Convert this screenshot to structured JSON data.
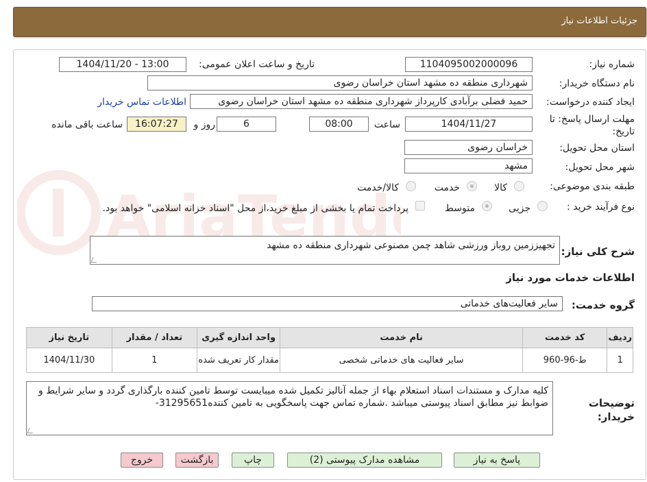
{
  "header": {
    "title": "جزئیات اطلاعات نیاز"
  },
  "watermark": {
    "text": "AriaTender.neT"
  },
  "fields": {
    "need_number_label": "شماره نیاز:",
    "need_number": "1104095002000096",
    "announce_label": "تاریخ و ساعت اعلان عمومی:",
    "announce_value": "1404/11/20 - 13:00",
    "buyer_label": "نام دستگاه خریدار:",
    "buyer_value": "شهرداری منطقه ده مشهد استان خراسان رضوی",
    "creator_label": "ایجاد کننده درخواست:",
    "creator_value": "حمید فضلی برآبادی کارپرداز شهرداری منطقه ده مشهد استان خراسان رضوی",
    "contact_link": "اطلاعات تماس خریدار",
    "deadline_label": "مهلت ارسال پاسخ: تا تاریخ:",
    "deadline_date": "1404/11/27",
    "time_label": "ساعت",
    "deadline_time": "08:00",
    "days_value": "6",
    "days_label": "روز و",
    "remaining_time": "16:07:27",
    "remaining_label": "ساعت باقی مانده",
    "province_label": "استان محل تحویل:",
    "province_value": "خراسان رضوی",
    "city_label": "شهر محل تحویل:",
    "city_value": "مشهد",
    "category_label": "طبقه بندی موضوعی:",
    "category_options": [
      "کالا",
      "خدمت",
      "کالا/خدمت"
    ],
    "category_selected": "خدمت",
    "process_label": "نوع فرآیند خرید :",
    "process_options": [
      "جزیی",
      "متوسط"
    ],
    "process_selected": "متوسط",
    "payment_note": "پرداخت تمام یا بخشی از مبلغ خرید،از محل \"اسناد خزانه اسلامی\" خواهد بود."
  },
  "description": {
    "label": "شرح کلی نیاز:",
    "value": "تجهیززمین روباز ورزشی شاهد چمن مصنوعی  شهرداری منطقه ده مشهد"
  },
  "services_section": {
    "title": "اطلاعات خدمات مورد نیاز",
    "group_label": "گروه خدمت:",
    "group_value": "سایر فعالیت‌های خدماتی"
  },
  "services_table": {
    "headers": [
      "ردیف",
      "کد خدمت",
      "نام خدمت",
      "واحد اندازه گیری",
      "تعداد / مقدار",
      "تاریخ نیاز"
    ],
    "rows": [
      {
        "row": "1",
        "code": "ط-96-960",
        "name": "سایر فعالیت های خدماتی شخصی",
        "unit": "مقدار کار تعریف شده",
        "qty": "1",
        "date": "1404/11/30"
      }
    ]
  },
  "buyer_notes": {
    "label": "توضیحات خریدار:",
    "value": "کلیه مدارک و مستندات اسناد استعلام بهاء  از جمله آنالیز تکمیل شده میبایست توسط تامین کننده بارگذاری گردد و سایر شرایط و ضوابط نیز مطابق اسناد پیوستی میباشد .شماره تماس جهت پاسخگویی به تامین کننده31295651-"
  },
  "buttons": {
    "respond": "پاسخ به نیاز",
    "attachments": "مشاهده مدارک پیوستی (2)",
    "print": "چاپ",
    "back": "بازگشت",
    "exit": "خروج"
  },
  "colors": {
    "header_bg": "#8c6a3c",
    "button_green": "#dcf0d6",
    "button_pink": "#f6c9cd",
    "timer_bg": "#f8f1c6",
    "link": "#1a3fa0"
  }
}
